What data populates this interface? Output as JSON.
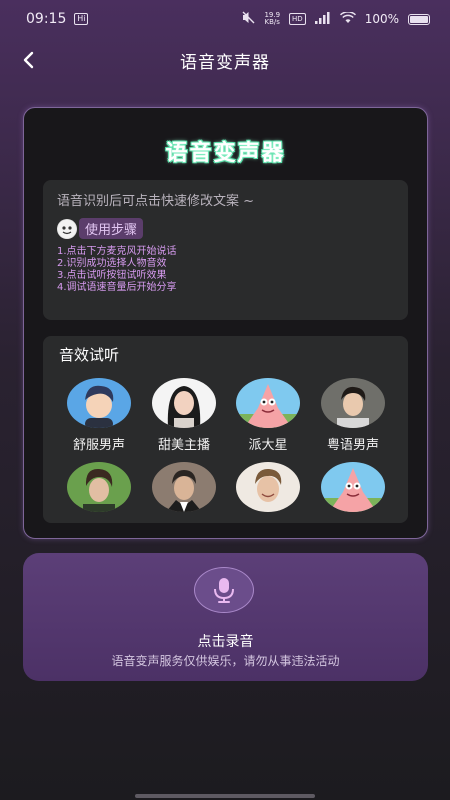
{
  "status_bar": {
    "time": "09:15",
    "notification_badge": "Hi",
    "speed_value": "19.9",
    "speed_unit": "KB/s",
    "hd_label": "HD",
    "battery": "100%"
  },
  "nav": {
    "title": "语音变声器"
  },
  "card": {
    "title": "语音变声器",
    "tips_intro": "语音识别后可点击快速修改文案 ~",
    "steps_tag": "使用步骤",
    "steps": [
      "1.点击下方麦克风开始说话",
      "2.识别成功选择人物音效",
      "3.点击试听按钮试听效果",
      "4.调试语速音量后开始分享"
    ]
  },
  "effects": {
    "title": "音效试听",
    "voices": [
      {
        "label": "舒服男声",
        "avatar": "cartoon-boy-avatar"
      },
      {
        "label": "甜美主播",
        "avatar": "woman-portrait-avatar"
      },
      {
        "label": "派大星",
        "avatar": "patrick-star-avatar"
      },
      {
        "label": "粤语男声",
        "avatar": "young-man-avatar"
      },
      {
        "label": "",
        "avatar": "curly-hair-man-avatar"
      },
      {
        "label": "",
        "avatar": "older-man-avatar"
      },
      {
        "label": "",
        "avatar": "smiling-man-avatar"
      },
      {
        "label": "",
        "avatar": "patrick-star-avatar-2"
      }
    ]
  },
  "record": {
    "label": "点击录音",
    "note": "语音变声服务仅供娱乐，请勿从事违法活动"
  },
  "colors": {
    "accent": "#5c3f78",
    "card_border": "#7e6699",
    "title_glow": "#3fd69b",
    "steps_text": "#d79bf0"
  }
}
